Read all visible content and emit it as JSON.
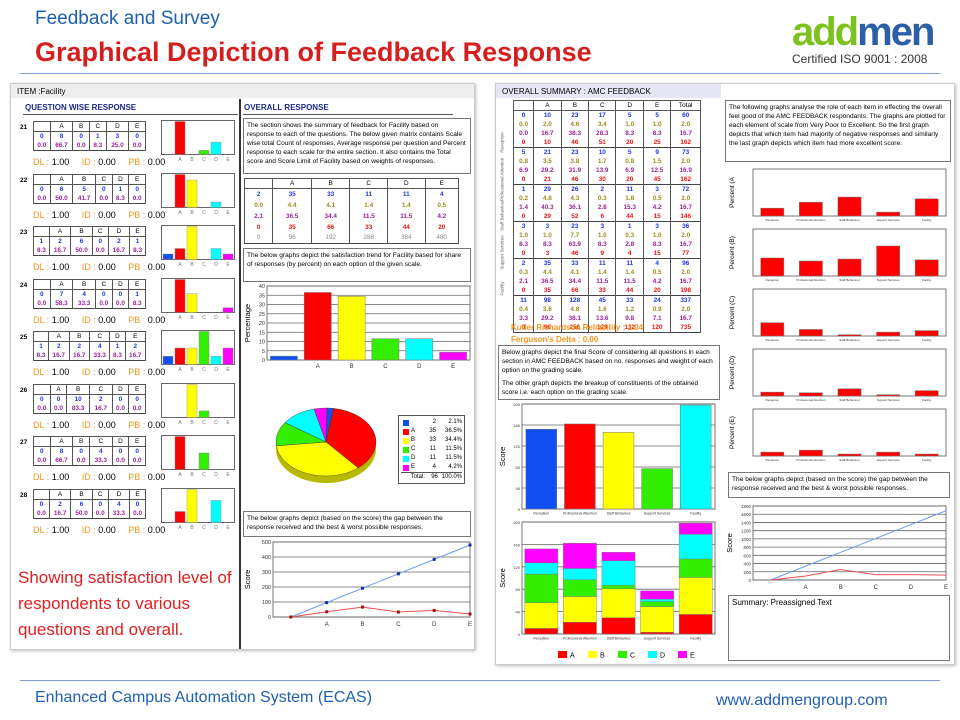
{
  "header": {
    "subtitle": "Feedback and Survey",
    "title": "Graphical Depiction of Feedback Response",
    "logo_text": "addmen",
    "iso": "Certified ISO 9001 : 2008"
  },
  "footer": {
    "left": "Enhanced Campus Automation System (ECAS)",
    "right": "www.addmengroup.com"
  },
  "note": "Showing satisfaction level of respondents to various questions and overall.",
  "colors": {
    "blank": "#1050f0",
    "A": "#ff0000",
    "B": "#ffff00",
    "C": "#33ee00",
    "D": "#00ffff",
    "E": "#ff00ff",
    "best_line": "#6a9ef0",
    "actual_line": "#f05050"
  },
  "left_panel": {
    "item": "ITEM :Facility",
    "section_qw": "QUESTION WISE RESPONSE",
    "section_overall": "OVERALL RESPONSE",
    "scale": [
      "",
      "A",
      "B",
      "C",
      "D",
      "E"
    ],
    "questions": [
      {
        "no": "21",
        "counts": [
          "0",
          "8",
          "0",
          "1",
          "3",
          "0"
        ],
        "pct": [
          "0.0",
          "66.7",
          "0.0",
          "8.3",
          "25.0",
          "0.0"
        ],
        "dl": "1.00",
        "id": "0.00",
        "pb": "0.00"
      },
      {
        "no": "22",
        "counts": [
          "0",
          "6",
          "5",
          "0",
          "1",
          "0"
        ],
        "pct": [
          "0.0",
          "50.0",
          "41.7",
          "0.0",
          "8.3",
          "0.0"
        ],
        "dl": "1.00",
        "id": "0.00",
        "pb": "0.00"
      },
      {
        "no": "23",
        "counts": [
          "1",
          "2",
          "6",
          "0",
          "2",
          "1"
        ],
        "pct": [
          "8.3",
          "16.7",
          "50.0",
          "0.0",
          "16.7",
          "8.3"
        ],
        "dl": "1.00",
        "id": "0.00",
        "pb": "0.00"
      },
      {
        "no": "24",
        "counts": [
          "0",
          "7",
          "4",
          "0",
          "0",
          "1"
        ],
        "pct": [
          "0.0",
          "58.3",
          "33.3",
          "0.0",
          "0.0",
          "8.3"
        ],
        "dl": "1.00",
        "id": "0.00",
        "pb": "0.00"
      },
      {
        "no": "25",
        "counts": [
          "1",
          "2",
          "2",
          "4",
          "1",
          "2"
        ],
        "pct": [
          "8.3",
          "16.7",
          "16.7",
          "33.3",
          "8.3",
          "16.7"
        ],
        "dl": "1.00",
        "id": "0.00",
        "pb": "0.00"
      },
      {
        "no": "26",
        "counts": [
          "0",
          "0",
          "10",
          "2",
          "0",
          "0"
        ],
        "pct": [
          "0.0",
          "0.0",
          "83.3",
          "16.7",
          "0.0",
          "0.0"
        ],
        "dl": "1.00",
        "id": "0.00",
        "pb": "0.00"
      },
      {
        "no": "27",
        "counts": [
          "0",
          "8",
          "0",
          "4",
          "0",
          "0"
        ],
        "pct": [
          "0.0",
          "66.7",
          "0.0",
          "33.3",
          "0.0",
          "0.0"
        ],
        "dl": "1.00",
        "id": "0.00",
        "pb": "0.00"
      },
      {
        "no": "28",
        "counts": [
          "0",
          "2",
          "6",
          "0",
          "4",
          "0"
        ],
        "pct": [
          "0.0",
          "16.7",
          "50.0",
          "0.0",
          "33.3",
          "0.0"
        ],
        "dl": "1.00",
        "id": "0.00",
        "pb": "0.00"
      }
    ],
    "dl_label": "DL :",
    "id_label": "ID :",
    "pb_label": "PB :",
    "overall_text": "The section shows the summary of feedback for Facility  based on response to each of the questions. The below given matrix contains Scale wise total Count of responses, Average response per question and Percent response to each scale for the entire section. It also contains the Total score and Score Limit of Facility based on weights of responses.",
    "overall_matrix": [
      [
        "2",
        "35",
        "33",
        "11",
        "11",
        "4"
      ],
      [
        "0.0",
        "4.4",
        "4.1",
        "1.4",
        "1.4",
        "0.5"
      ],
      [
        "2.1",
        "36.5",
        "34.4",
        "11.5",
        "11.5",
        "4.2"
      ],
      [
        "0",
        "35",
        "66",
        "33",
        "44",
        "20"
      ],
      [
        "0",
        "96",
        "192",
        "288",
        "384",
        "480"
      ]
    ],
    "trend_text": "The below graphs depict the satisfaction trend for Facility based for share of  responses (by percent) on each option of the given scale.",
    "gap_text": "The below graphs depict (based on the score) the gap between the response received  and the best & worst possible responses.",
    "pie_legend": [
      {
        "label": "",
        "count": "2",
        "pct": "2.1%"
      },
      {
        "label": "A",
        "count": "35",
        "pct": "36.5%"
      },
      {
        "label": "B",
        "count": "33",
        "pct": "34.4%"
      },
      {
        "label": "C",
        "count": "11",
        "pct": "11.5%"
      },
      {
        "label": "D",
        "count": "11",
        "pct": "11.5%"
      },
      {
        "label": "E",
        "count": "4",
        "pct": "4.2%"
      }
    ],
    "pie_total": {
      "label": "Total:",
      "count": "96",
      "pct": "100.0%"
    }
  },
  "right_panel": {
    "title": "OVERALL SUMMARY : AMC FEEDBACK",
    "columns": [
      "",
      "A",
      "B",
      "C",
      "D",
      "E",
      "Total"
    ],
    "groups": [
      {
        "name": "Reception",
        "rows": [
          [
            "0",
            "10",
            "23",
            "17",
            "5",
            "5",
            "60"
          ],
          [
            "0.0",
            "2.0",
            "4.6",
            "3.4",
            "1.0",
            "1.0",
            "2.0"
          ],
          [
            "0.0",
            "16.7",
            "38.3",
            "28.3",
            "8.3",
            "8.3",
            "16.7"
          ],
          [
            "0",
            "10",
            "46",
            "51",
            "20",
            "25",
            "162"
          ]
        ]
      },
      {
        "name": "Professional Attention",
        "rows": [
          [
            "5",
            "21",
            "23",
            "10",
            "5",
            "9",
            "73"
          ],
          [
            "0.8",
            "3.5",
            "3.8",
            "1.7",
            "0.8",
            "1.5",
            "2.0"
          ],
          [
            "6.9",
            "29.2",
            "31.9",
            "13.9",
            "6.9",
            "12.5",
            "16.9"
          ],
          [
            "0",
            "21",
            "46",
            "30",
            "20",
            "45",
            "162"
          ]
        ]
      },
      {
        "name": "Staff Behaviour",
        "rows": [
          [
            "1",
            "29",
            "26",
            "2",
            "11",
            "3",
            "72"
          ],
          [
            "0.2",
            "4.8",
            "4.3",
            "0.3",
            "1.8",
            "0.5",
            "2.0"
          ],
          [
            "1.4",
            "40.3",
            "36.1",
            "2.8",
            "15.3",
            "4.2",
            "16.7"
          ],
          [
            "0",
            "29",
            "52",
            "6",
            "44",
            "15",
            "146"
          ]
        ]
      },
      {
        "name": "Support Services",
        "rows": [
          [
            "3",
            "3",
            "23",
            "3",
            "1",
            "3",
            "36"
          ],
          [
            "1.0",
            "1.0",
            "7.7",
            "1.0",
            "0.3",
            "1.0",
            "2.0"
          ],
          [
            "8.3",
            "8.3",
            "63.9",
            "8.3",
            "2.8",
            "8.3",
            "16.7"
          ],
          [
            "0",
            "3",
            "46",
            "9",
            "4",
            "15",
            "77"
          ]
        ]
      },
      {
        "name": "Facility",
        "rows": [
          [
            "2",
            "35",
            "33",
            "11",
            "11",
            "4",
            "96"
          ],
          [
            "0.3",
            "4.4",
            "4.1",
            "1.4",
            "1.4",
            "0.5",
            "2.0"
          ],
          [
            "2.1",
            "36.5",
            "34.4",
            "11.5",
            "11.5",
            "4.2",
            "16.7"
          ],
          [
            "0",
            "35",
            "66",
            "33",
            "44",
            "20",
            "198"
          ]
        ]
      },
      {
        "name": "",
        "rows": [
          [
            "11",
            "98",
            "128",
            "45",
            "33",
            "24",
            "337"
          ],
          [
            "0.4",
            "3.6",
            "4.8",
            "1.6",
            "1.2",
            "0.9",
            "2.0"
          ],
          [
            "3.3",
            "29.2",
            "38.1",
            "13.6",
            "9.8",
            "7.1",
            "16.7"
          ],
          [
            "0",
            "98",
            "256",
            "129",
            "132",
            "120",
            "735"
          ]
        ]
      }
    ],
    "kr": "Kuder Richardson Reliability : 1.04",
    "fd": "Ferguson's Delta : 0.00",
    "score_text_1": "Below graphs depict the final Score of considering all questions in each section in  AMC FEEDBACK  based on no. responses and weight of each option on the grading scale.",
    "score_text_2": "The other graph depicts the breakup of constituents of the obtained score i.e. each option on the grading scale.",
    "role_text": "The following graphs analyse the role of each item in effecting the overall feel good of the AMC FEEDBACK respondants. The graphs are plotted for each element of scale from Very Poor to Excellent. So the first graph depicts that which item had majority of negative responses and similarly the last graph depicts which item had more excellent score.",
    "gap_text": "The below graphs depict (based on the score) the gap between the response received  and the best & worst possible responses.",
    "summary": "Summary: Preassigned Text"
  },
  "chart_data": [
    {
      "id": "facility_percent",
      "type": "bar",
      "categories": [
        "",
        "A",
        "B",
        "C",
        "D",
        "E"
      ],
      "values": [
        2.1,
        36.5,
        34.4,
        11.5,
        11.5,
        4.2
      ],
      "ylabel": "Percentage",
      "ylim": [
        0,
        40
      ],
      "yticks": [
        0,
        5,
        10,
        15,
        20,
        25,
        30,
        35,
        40
      ],
      "grid": true
    },
    {
      "id": "facility_pie",
      "type": "pie",
      "categories": [
        "",
        "A",
        "B",
        "C",
        "D",
        "E"
      ],
      "values": [
        2,
        35,
        33,
        11,
        11,
        4
      ]
    },
    {
      "id": "facility_gap",
      "type": "line",
      "x": [
        "",
        "A",
        "B",
        "C",
        "D",
        "E"
      ],
      "series": [
        {
          "values": [
            0,
            96,
            192,
            288,
            384,
            480
          ]
        },
        {
          "values": [
            0,
            35,
            66,
            33,
            44,
            20
          ]
        }
      ],
      "ylabel": "Score",
      "ylim": [
        0,
        500
      ],
      "yticks": [
        0,
        100,
        200,
        300,
        400,
        500
      ],
      "grid": true
    },
    {
      "id": "amc_score",
      "type": "bar",
      "categories": [
        "Reception",
        "Professional Attention",
        "Staff Behaviour",
        "Support Services",
        "Facility"
      ],
      "values": [
        152,
        162,
        146,
        77,
        198
      ],
      "ylabel": "Score",
      "ylim": [
        0,
        200
      ],
      "yticks": [
        0,
        40,
        80,
        120,
        160,
        200
      ],
      "grid": true
    },
    {
      "id": "amc_stacked",
      "type": "bar",
      "stacked": true,
      "categories": [
        "Reception",
        "Professional Attention",
        "Staff Behaviour",
        "Support Services",
        "Facility"
      ],
      "series": [
        {
          "name": "A",
          "values": [
            10,
            21,
            29,
            3,
            35
          ]
        },
        {
          "name": "B",
          "values": [
            46,
            46,
            52,
            46,
            66
          ]
        },
        {
          "name": "C",
          "values": [
            51,
            30,
            6,
            9,
            33
          ]
        },
        {
          "name": "D",
          "values": [
            20,
            20,
            44,
            4,
            44
          ]
        },
        {
          "name": "E",
          "values": [
            25,
            45,
            15,
            15,
            20
          ]
        }
      ],
      "ylabel": "Score",
      "ylim": [
        0,
        200
      ],
      "yticks": [
        0,
        40,
        80,
        120,
        160,
        200
      ],
      "legend": "bottom",
      "grid": true
    },
    {
      "id": "pct_A",
      "type": "bar",
      "categories": [
        "Reception",
        "Professional Attention",
        "Staff Behaviour",
        "Support Services",
        "Facility"
      ],
      "values": [
        16.7,
        29.2,
        40.3,
        8.3,
        36.5
      ],
      "ylabel": "Percent (A",
      "ylim": [
        0,
        100
      ]
    },
    {
      "id": "pct_B",
      "type": "bar",
      "categories": [
        "Reception",
        "Professional Attention",
        "Staff Behaviour",
        "Support Services",
        "Facility"
      ],
      "values": [
        38.3,
        31.9,
        36.1,
        63.9,
        34.4
      ],
      "ylabel": "Percent (B)",
      "ylim": [
        0,
        100
      ]
    },
    {
      "id": "pct_C",
      "type": "bar",
      "categories": [
        "Reception",
        "Professional Attention",
        "Staff Behaviour",
        "Support Services",
        "Facility"
      ],
      "values": [
        28.3,
        13.9,
        2.8,
        8.3,
        11.5
      ],
      "ylabel": "Percent (C)",
      "ylim": [
        0,
        100
      ]
    },
    {
      "id": "pct_D",
      "type": "bar",
      "categories": [
        "Reception",
        "Professional Attention",
        "Staff Behaviour",
        "Support Services",
        "Facility"
      ],
      "values": [
        8.3,
        6.9,
        15.3,
        2.8,
        11.5
      ],
      "ylabel": "Percent (D)",
      "ylim": [
        0,
        100
      ]
    },
    {
      "id": "pct_E",
      "type": "bar",
      "categories": [
        "Reception",
        "Professional Attention",
        "Staff Behaviour",
        "Support Services",
        "Facility"
      ],
      "values": [
        8.3,
        12.5,
        4.2,
        8.3,
        4.2
      ],
      "ylabel": "Percent (E)",
      "ylim": [
        0,
        100
      ]
    },
    {
      "id": "amc_gap",
      "type": "line",
      "x": [
        "",
        "A",
        "B",
        "C",
        "D",
        "E"
      ],
      "series": [
        {
          "values": [
            0,
            337,
            674,
            1011,
            1348,
            1685
          ]
        },
        {
          "values": [
            0,
            98,
            256,
            129,
            132,
            120
          ]
        }
      ],
      "ylabel": "Score",
      "ylim": [
        0,
        1800
      ],
      "yticks": [
        0,
        200,
        400,
        600,
        800,
        1000,
        1200,
        1400,
        1600,
        1800
      ],
      "grid": true
    }
  ]
}
